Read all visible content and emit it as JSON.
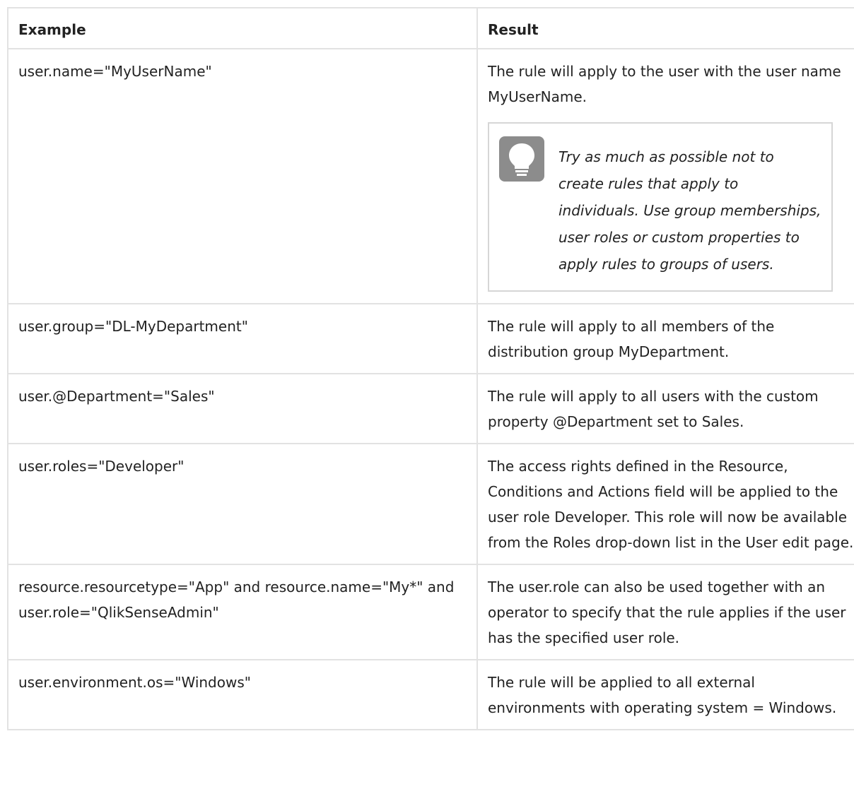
{
  "table": {
    "headers": [
      "Example",
      "Result"
    ],
    "rows": [
      {
        "example": "user.name=\"MyUserName\"",
        "result": "The rule will apply to the user with the user name MyUserName.",
        "tip": "Try as much as possible not to create rules that apply to individuals. Use group memberships, user roles or custom properties to apply rules to groups of users."
      },
      {
        "example": "user.group=\"DL-MyDepartment\"",
        "result": "The rule will apply to all members of the distribution group MyDepartment."
      },
      {
        "example": "user.@Department=\"Sales\"",
        "result": "The rule will apply to all users with the custom property @Department set to Sales."
      },
      {
        "example": "user.roles=\"Developer\"",
        "result": "The access rights defined in the Resource, Conditions and Actions field will be applied to the user role Developer. This role will now be available from the Roles drop-down list in the User edit page."
      },
      {
        "example": "resource.resourcetype=\"App\" and resource.name=\"My*\" and user.role=\"QlikSenseAdmin\"",
        "result": "The user.role can also be used together with an operator to specify that the rule applies if the user has the specified user role."
      },
      {
        "example": "user.environment.os=\"Windows\"",
        "result": "The rule will be applied to all external environments with operating system = Windows."
      }
    ]
  },
  "icons": {
    "tip": "lightbulb-icon"
  },
  "colors": {
    "border": "#e2e2e2",
    "tip_border": "#d6d6d6",
    "icon_bg": "#8c8c8c",
    "text": "#222222"
  }
}
